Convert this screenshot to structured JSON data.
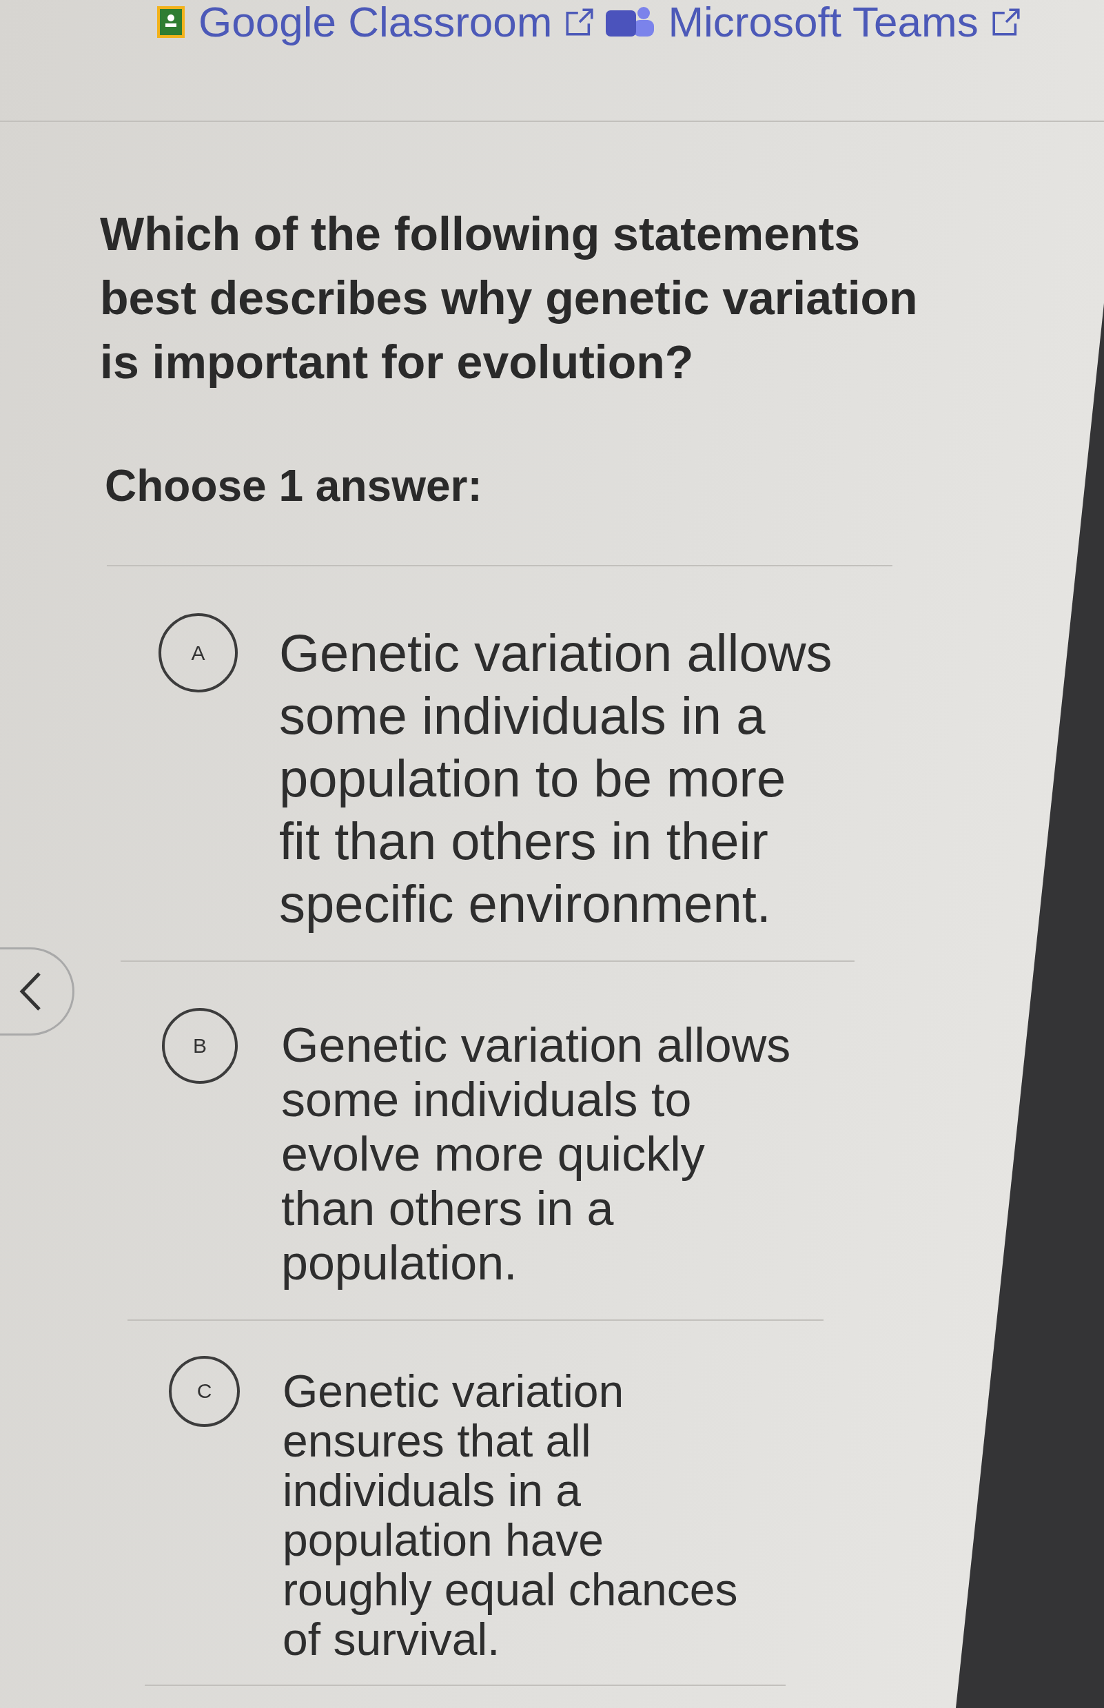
{
  "header_links": [
    {
      "kind": "classroom",
      "label": "Google Classroom"
    },
    {
      "kind": "teams",
      "label": "Microsoft Teams"
    }
  ],
  "question": {
    "prompt": "Which of the following statements best describes why genetic variation is important for evolution?",
    "instruction": "Choose 1 answer:"
  },
  "choices": [
    {
      "letter": "A",
      "text": "Genetic variation allows some individuals in a population to be more fit than others in their specific environment.",
      "selected": false
    },
    {
      "letter": "B",
      "text": "Genetic variation allows some individuals to evolve more quickly than others in a population.",
      "selected": false
    },
    {
      "letter": "C",
      "text": "Genetic variation ensures that all individuals in a population have roughly equal chances of survival.",
      "selected": false
    }
  ]
}
